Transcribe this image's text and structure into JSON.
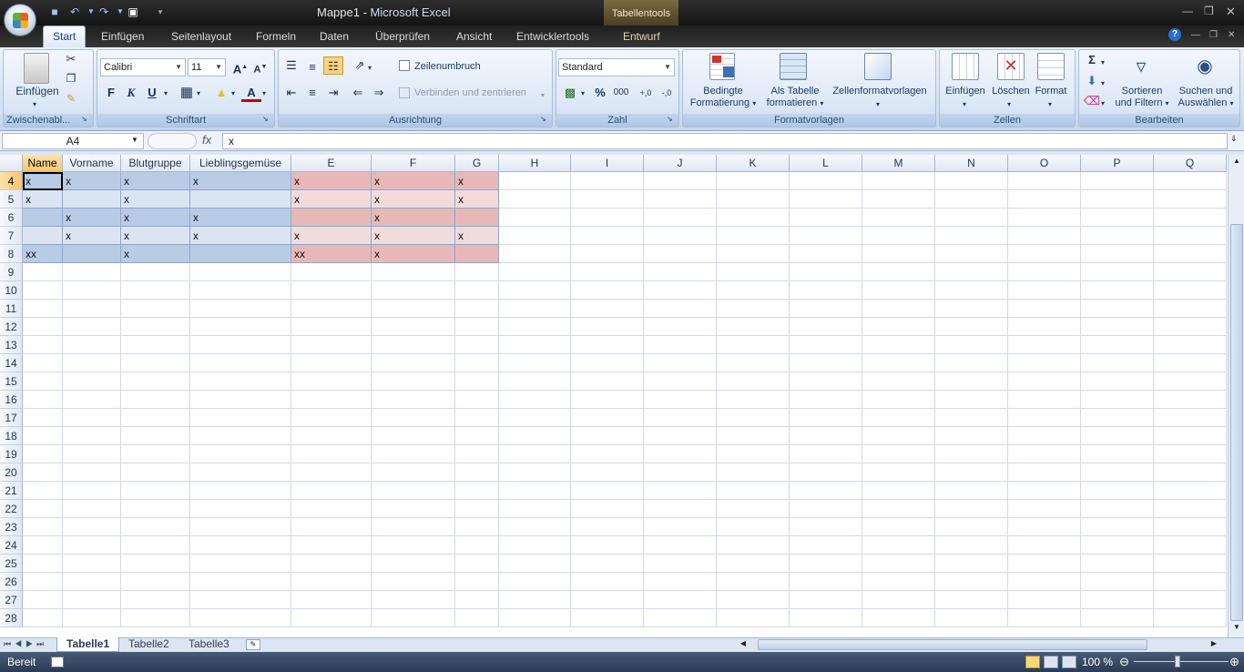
{
  "window": {
    "title_doc": "Mappe1",
    "title_sep": " - ",
    "title_app": "Microsoft Excel",
    "context_tab": "Tabellentools"
  },
  "tabs": [
    "Start",
    "Einfügen",
    "Seitenlayout",
    "Formeln",
    "Daten",
    "Überprüfen",
    "Ansicht",
    "Entwicklertools",
    "Entwurf"
  ],
  "ribbon": {
    "clipboard": {
      "label": "Zwischenabl...",
      "paste": "Einfügen"
    },
    "font": {
      "label": "Schriftart",
      "font_name": "Calibri",
      "font_size": "11",
      "bold": "F",
      "italic": "K",
      "underline": "U"
    },
    "alignment": {
      "label": "Ausrichtung",
      "wrap": "Zeilenumbruch",
      "merge": "Verbinden und zentrieren"
    },
    "number": {
      "label": "Zahl",
      "format": "Standard",
      "percent": "%",
      "thousands": "000",
      "inc_dec": "+,0",
      "dec_dec": "-,0"
    },
    "styles": {
      "label": "Formatvorlagen",
      "cond_1": "Bedingte",
      "cond_2": "Formatierung",
      "table_1": "Als Tabelle",
      "table_2": "formatieren",
      "cell_styles": "Zellenformatvorlagen"
    },
    "cells": {
      "label": "Zellen",
      "insert": "Einfügen",
      "delete": "Löschen",
      "format": "Format"
    },
    "editing": {
      "label": "Bearbeiten",
      "sigma": "Σ",
      "sort_1": "Sortieren",
      "sort_2": "und Filtern",
      "find_1": "Suchen und",
      "find_2": "Auswählen"
    }
  },
  "formula_bar": {
    "name_box": "A4",
    "fx": "fx",
    "value": "x"
  },
  "columns": [
    "Name",
    "Vorname",
    "Blutgruppe",
    "Lieblingsgemüse",
    "E",
    "F",
    "G",
    "H",
    "I",
    "J",
    "K",
    "L",
    "M",
    "N",
    "O",
    "P",
    "Q"
  ],
  "rows": [
    "4",
    "5",
    "6",
    "7",
    "8",
    "9",
    "10",
    "11",
    "12",
    "13",
    "14",
    "15",
    "16",
    "17",
    "18",
    "19",
    "20",
    "21",
    "22",
    "23",
    "24",
    "25",
    "26",
    "27",
    "28"
  ],
  "cells": [
    [
      "x",
      "x",
      "x",
      "x",
      "x",
      "x",
      "x"
    ],
    [
      "x",
      "",
      "x",
      "",
      "x",
      "x",
      "x"
    ],
    [
      "",
      "x",
      "x",
      "x",
      "",
      "x",
      ""
    ],
    [
      "",
      "x",
      "x",
      "x",
      "x",
      "x",
      "x"
    ],
    [
      "xx",
      "",
      "x",
      "",
      "xx",
      "x",
      ""
    ]
  ],
  "sheets": [
    "Tabelle1",
    "Tabelle2",
    "Tabelle3"
  ],
  "status": {
    "ready": "Bereit",
    "zoom": "100 %"
  }
}
